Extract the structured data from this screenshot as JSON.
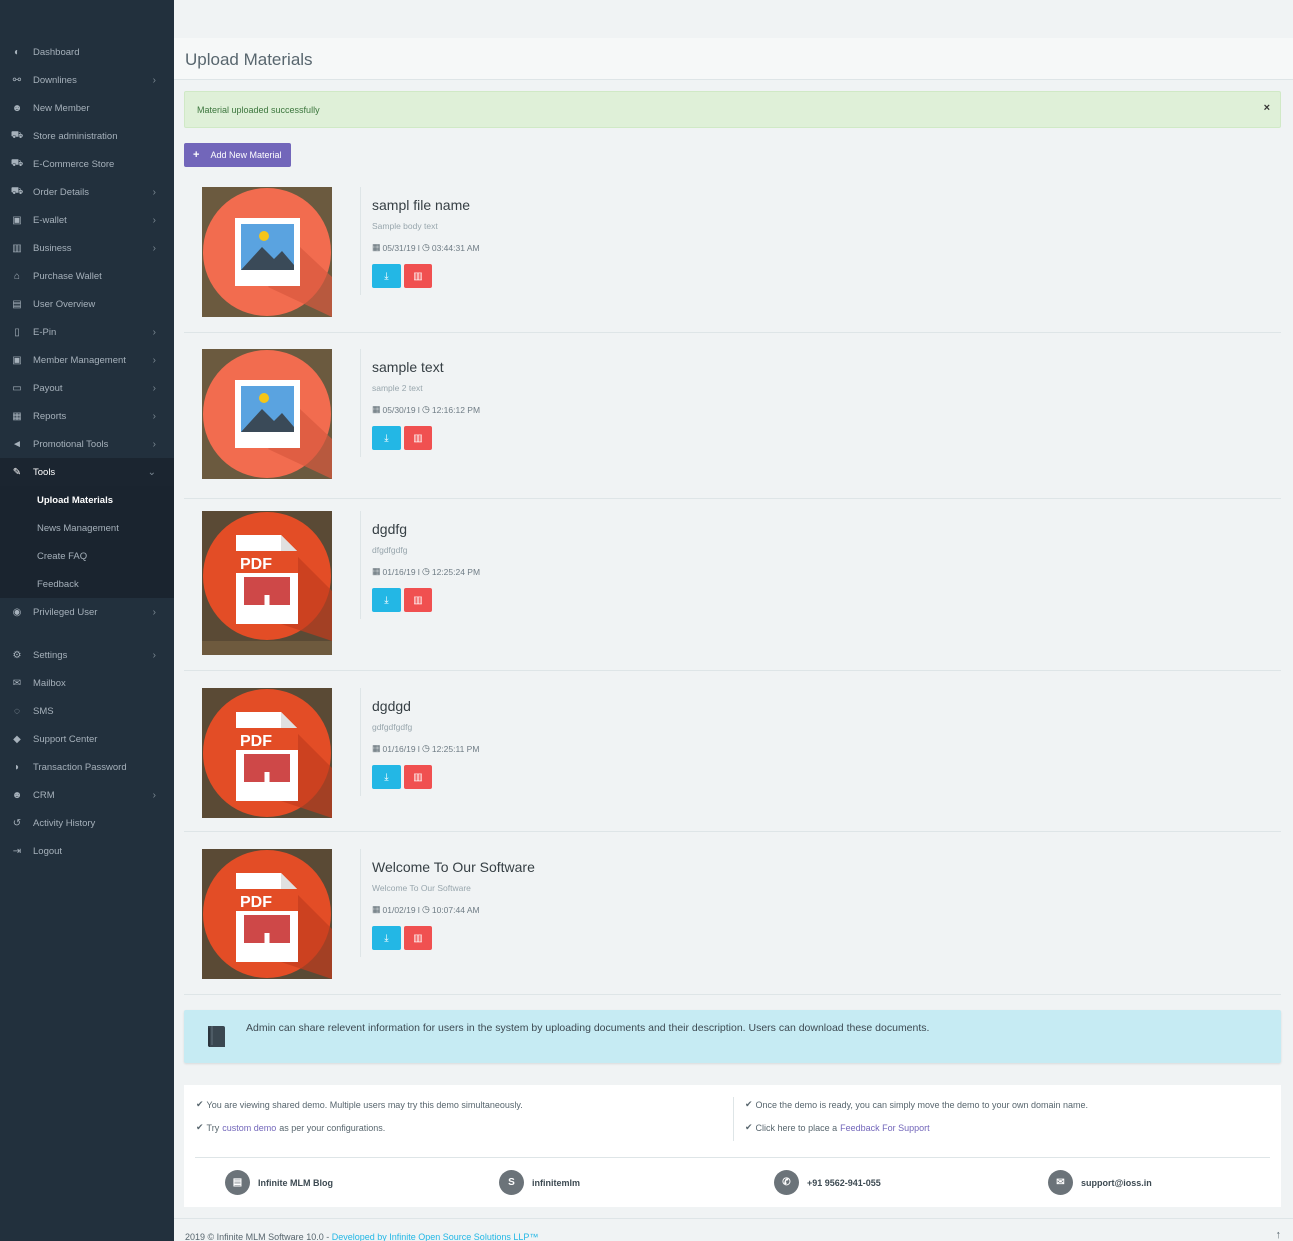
{
  "sidebar": {
    "items": [
      {
        "label": "Dashboard",
        "icon": "dashboard-icon",
        "glyph": "◐",
        "chevron": false
      },
      {
        "label": "Downlines",
        "icon": "sitemap-icon",
        "glyph": "⚯",
        "chevron": true
      },
      {
        "label": "New Member",
        "icon": "user-plus-icon",
        "glyph": "☻",
        "chevron": false
      },
      {
        "label": "Store administration",
        "icon": "cart-icon",
        "glyph": "⛟",
        "chevron": false
      },
      {
        "label": "E-Commerce Store",
        "icon": "shopping-cart-icon",
        "glyph": "⛟",
        "chevron": false
      },
      {
        "label": "Order Details",
        "icon": "shopping-cart-icon",
        "glyph": "⛟",
        "chevron": true
      },
      {
        "label": "E-wallet",
        "icon": "briefcase-icon",
        "glyph": "▣",
        "chevron": true
      },
      {
        "label": "Business",
        "icon": "building-icon",
        "glyph": "▥",
        "chevron": true
      },
      {
        "label": "Purchase Wallet",
        "icon": "bank-icon",
        "glyph": "⌂",
        "chevron": false
      },
      {
        "label": "User Overview",
        "icon": "id-card-icon",
        "glyph": "▤",
        "chevron": false
      },
      {
        "label": "E-Pin",
        "icon": "bookmark-icon",
        "glyph": "▯",
        "chevron": true
      },
      {
        "label": "Member Management",
        "icon": "user-card-icon",
        "glyph": "▣",
        "chevron": true
      },
      {
        "label": "Payout",
        "icon": "money-icon",
        "glyph": "▭",
        "chevron": true
      },
      {
        "label": "Reports",
        "icon": "bar-chart-icon",
        "glyph": "▦",
        "chevron": true
      },
      {
        "label": "Promotional Tools",
        "icon": "bullhorn-icon",
        "glyph": "◄",
        "chevron": true
      },
      {
        "label": "Tools",
        "icon": "wrench-icon",
        "glyph": "✎",
        "chevron": true,
        "expanded": true
      }
    ],
    "tools_submenu": [
      {
        "label": "Upload Materials",
        "current": true
      },
      {
        "label": "News Management",
        "current": false
      },
      {
        "label": "Create FAQ",
        "current": false
      },
      {
        "label": "Feedback",
        "current": false
      }
    ],
    "items_after": [
      {
        "label": "Privileged User",
        "icon": "user-circle-icon",
        "glyph": "◉",
        "chevron": true
      },
      {
        "label": "Settings",
        "icon": "cogs-icon",
        "glyph": "⚙",
        "chevron": true
      },
      {
        "label": "Mailbox",
        "icon": "envelope-icon",
        "glyph": "✉",
        "chevron": false
      },
      {
        "label": "SMS",
        "icon": "comments-icon",
        "glyph": "◌",
        "chevron": false
      },
      {
        "label": "Support Center",
        "icon": "ticket-icon",
        "glyph": "◆",
        "chevron": false
      },
      {
        "label": "Transaction Password",
        "icon": "shield-icon",
        "glyph": "◗",
        "chevron": false
      },
      {
        "label": "CRM",
        "icon": "users-icon",
        "glyph": "☻",
        "chevron": true
      },
      {
        "label": "Activity History",
        "icon": "history-icon",
        "glyph": "↺",
        "chevron": false
      },
      {
        "label": "Logout",
        "icon": "sign-out-icon",
        "glyph": "⇥",
        "chevron": false
      }
    ]
  },
  "page": {
    "title": "Upload Materials",
    "alert": "Material uploaded successfully",
    "alert_close": "×",
    "add_button": "Add New Material",
    "add_glyph": "+"
  },
  "materials": [
    {
      "title": "sampl file name",
      "body": "Sample body text",
      "date": "05/31/19",
      "time": "03:44:31 AM",
      "kind": "image"
    },
    {
      "title": "sample text",
      "body": "sample 2 text",
      "date": "05/30/19",
      "time": "12:16:12 PM",
      "kind": "image"
    },
    {
      "title": "dgdfg",
      "body": "dfgdfgdfg",
      "date": "01/16/19",
      "time": "12:25:24 PM",
      "kind": "pdf"
    },
    {
      "title": "dgdgd",
      "body": "gdfgdfgdfg",
      "date": "01/16/19",
      "time": "12:25:11 PM",
      "kind": "pdf"
    },
    {
      "title": "Welcome To Our Software",
      "body": "Welcome To Our Software",
      "date": "01/02/19",
      "time": "10:07:44 AM",
      "kind": "pdf"
    }
  ],
  "pdf_label": "PDF",
  "date_separator": "I",
  "info": {
    "text": "Admin can share relevent information for users in the system by uploading documents and their description. Users can download these documents."
  },
  "demo": {
    "line1": "You are viewing shared demo. Multiple users may try this demo simultaneously.",
    "line2_prefix": "Try",
    "line2_link": "custom demo",
    "line2_suffix": "as per your configurations.",
    "line3": "Once the demo is ready, you can simply move the demo to your own domain name.",
    "line4_prefix": "Click here to place a",
    "line4_link": "Feedback For Support"
  },
  "contacts": [
    {
      "label": "Infinite MLM Blog",
      "icon": "newspaper-icon",
      "glyph": "▤"
    },
    {
      "label": "infinitemlm",
      "icon": "skype-icon",
      "glyph": "S"
    },
    {
      "label": "+91 9562-941-055",
      "icon": "whatsapp-icon",
      "glyph": "✆"
    },
    {
      "label": "support@ioss.in",
      "icon": "envelope-icon",
      "glyph": "✉"
    }
  ],
  "footer": {
    "text": "2019 © Infinite MLM Software 10.0 -",
    "link": "Developed by Infinite Open Source Solutions LLP™",
    "to_top": "↑"
  },
  "colors": {
    "sidebar_bg": "#22303d",
    "primary": "#7266ba",
    "info": "#23b7e5",
    "danger": "#f05050",
    "success_bg": "#dff0d8"
  }
}
